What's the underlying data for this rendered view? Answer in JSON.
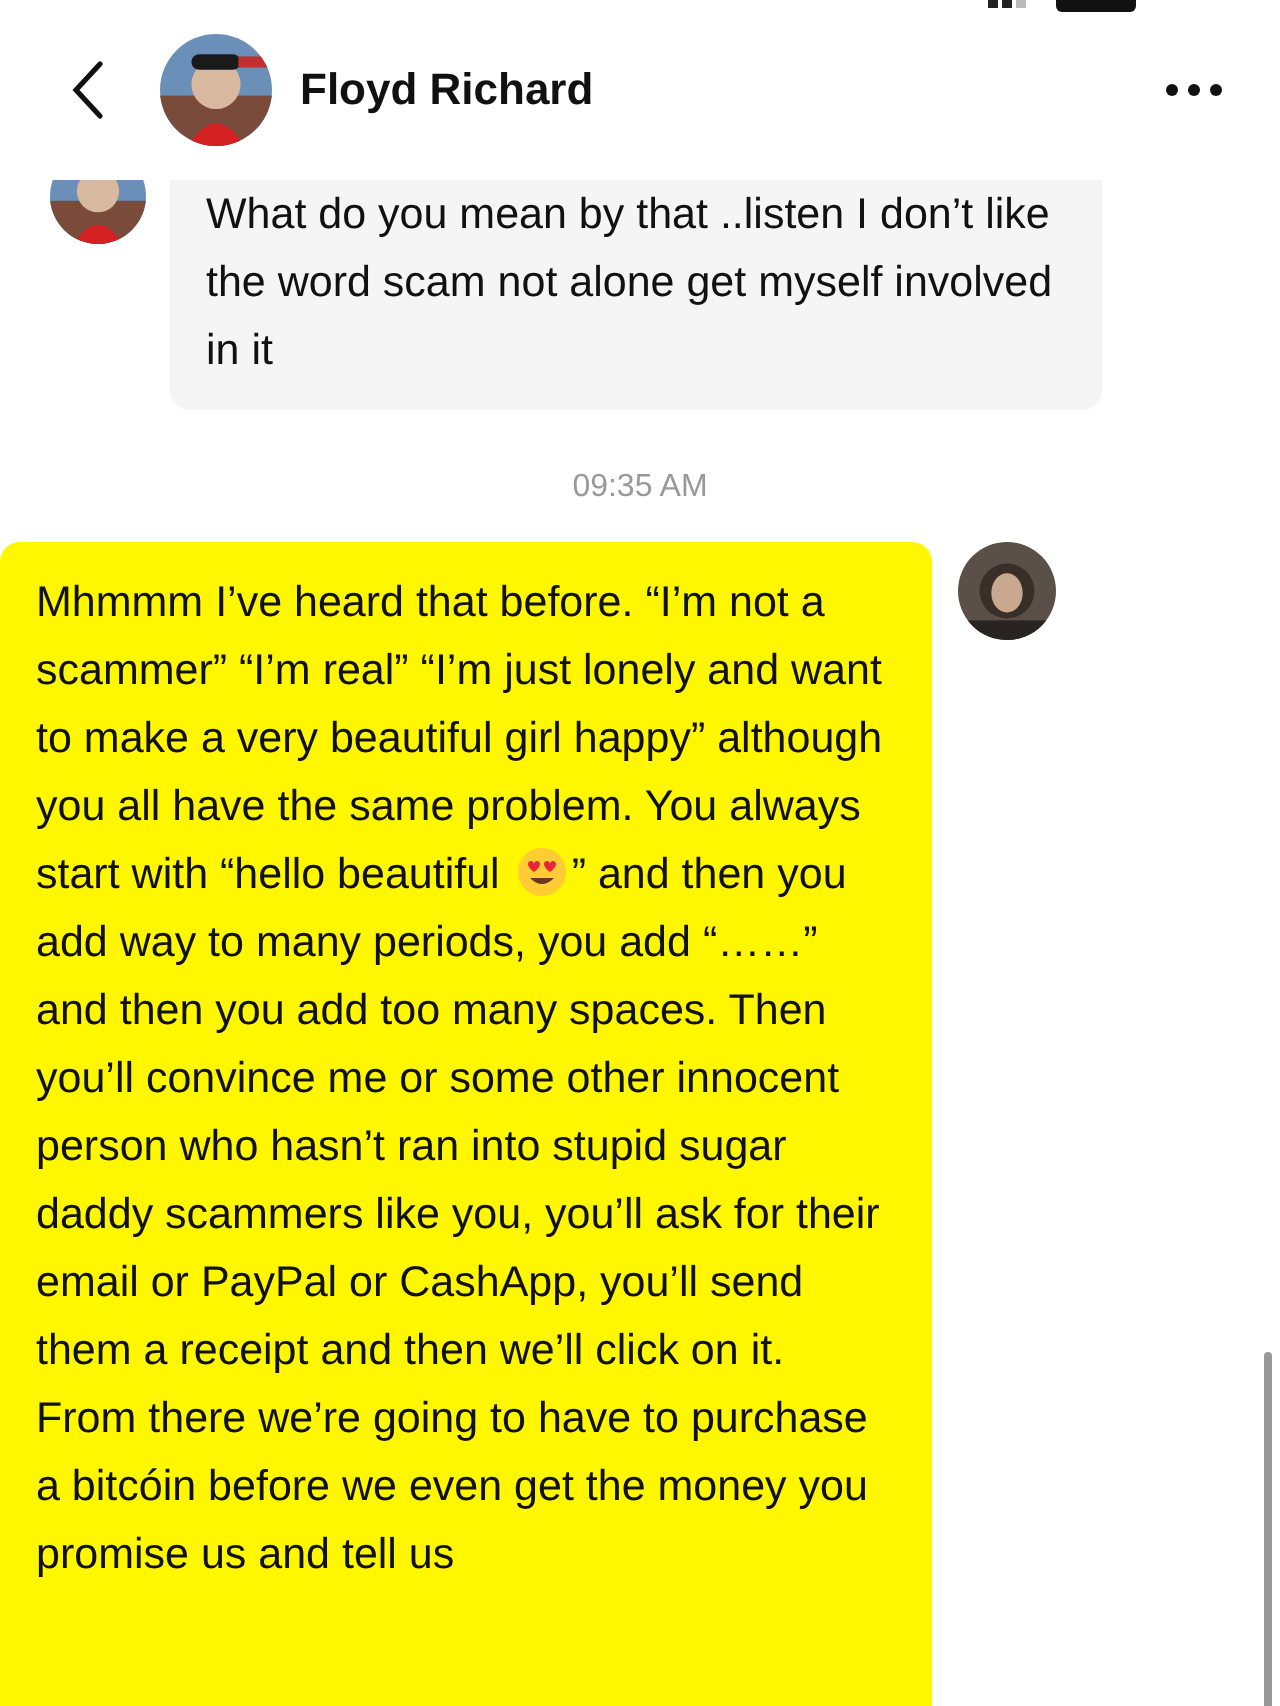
{
  "header": {
    "contact_name": "Floyd Richard"
  },
  "messages": [
    {
      "kind": "incoming",
      "text_parts": [
        "What do you mean by that ..listen I don’t like the word scam not alone get myself involved in it"
      ]
    },
    {
      "kind": "timestamp",
      "text_parts": [
        "09:35 AM"
      ]
    },
    {
      "kind": "outgoing",
      "text_parts": [
        "Mhmmm I’ve heard that before. “I’m not a scammer” “I’m real” “I’m just lonely and want to make a very beautiful girl happy” although you all have the same problem. You always start with “hello beautiful ",
        "” and then you add way to many periods, you add “……” and then you add too many spaces. Then you’ll convince me or some other innocent person who hasn’t ran into stupid sugar daddy scammers like you, you’ll ask for their email or PayPal or CashApp, you’ll send them a receipt and then we’ll click on it. From there we’re going to have to purchase a bitcóin before we even get the money you promise us and tell us"
      ]
    }
  ]
}
